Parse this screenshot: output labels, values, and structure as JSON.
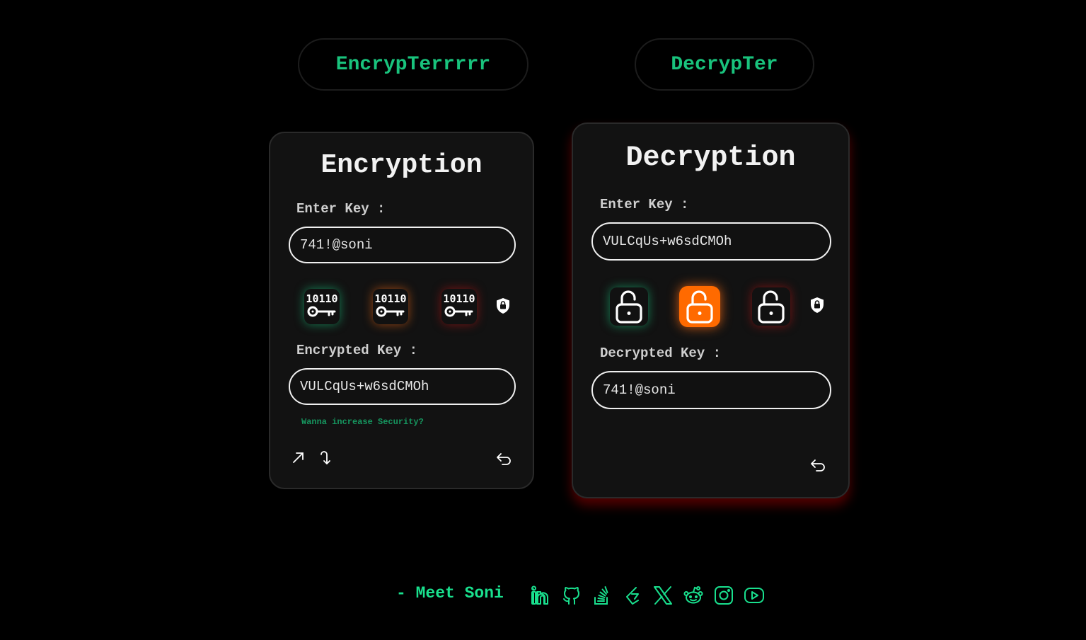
{
  "tabs": {
    "encrypt_label": "EncrypTerrrrr",
    "decrypt_label": "DecrypTer"
  },
  "encryption": {
    "title": "Encryption",
    "enter_key_label": "Enter Key :",
    "key_value": "741!@soni",
    "icons": [
      "binary-key-icon-green",
      "binary-key-icon-orange",
      "binary-key-icon-red",
      "shield-lock-icon"
    ],
    "encrypted_key_label": "Encrypted Key :",
    "encrypted_value": "VULCqUs+w6sdCMOh",
    "hint": "Wanna increase Security?",
    "footer_icons": [
      "arrow-up-right-icon",
      "arrow-return-down-icon",
      "undo-icon"
    ]
  },
  "decryption": {
    "title": "Decryption",
    "enter_key_label": "Enter Key :",
    "key_value": "VULCqUs+w6sdCMOh",
    "icons": [
      "unlock-icon-green",
      "unlock-icon-orange-active",
      "unlock-icon-red",
      "shield-lock-icon"
    ],
    "decrypted_key_label": "Decrypted Key :",
    "decrypted_value": "741!@soni",
    "footer_icons": [
      "undo-icon"
    ]
  },
  "footer": {
    "text": "- Meet Soni",
    "social_icons": [
      "linkedin-icon",
      "github-icon",
      "stackoverflow-icon",
      "codepen-icon",
      "x-icon",
      "reddit-icon",
      "instagram-icon",
      "youtube-icon"
    ]
  },
  "colors": {
    "accent_green": "#19c37d",
    "accent_orange": "#ff6a00",
    "glow_red": "#c81414",
    "card_bg": "#121212",
    "page_bg": "#000000"
  }
}
